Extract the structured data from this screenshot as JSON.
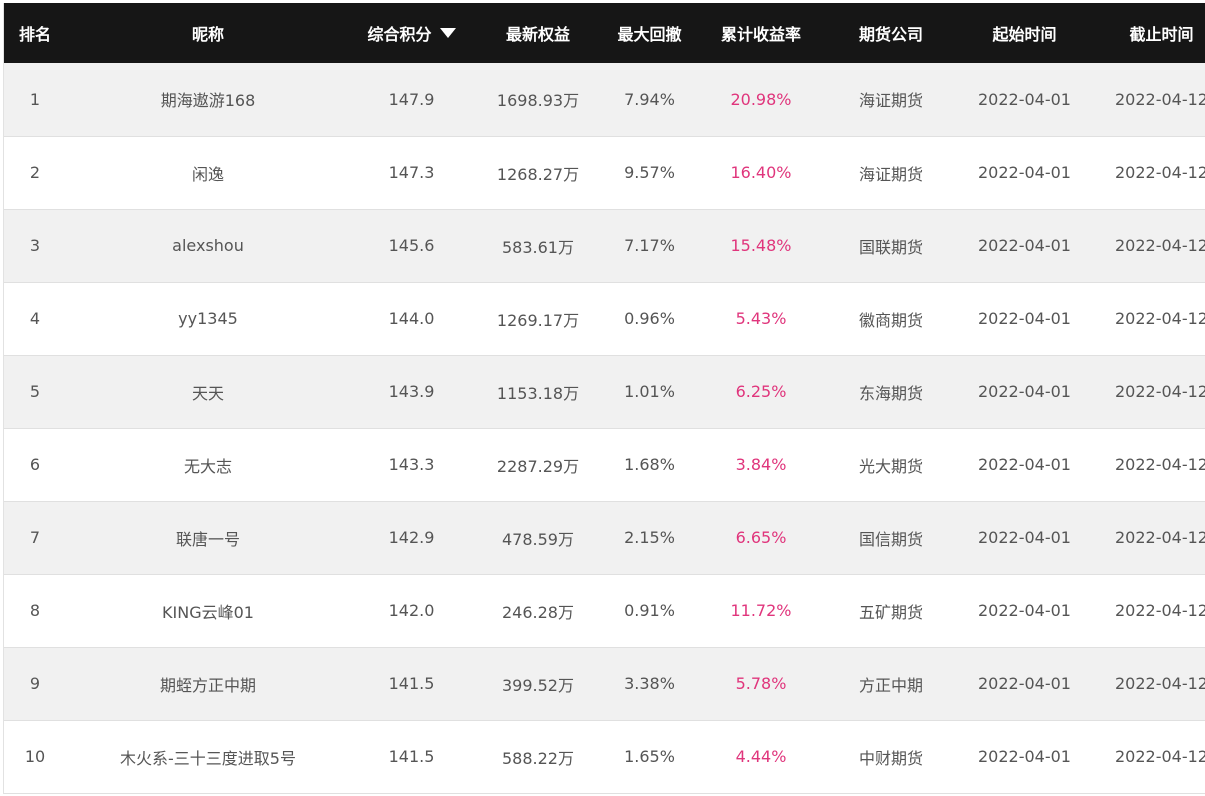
{
  "columns": {
    "rank": "排名",
    "nickname": "昵称",
    "score": "综合积分",
    "equity": "最新权益",
    "drawdown": "最大回撤",
    "return": "累计收益率",
    "company": "期货公司",
    "start": "起始时间",
    "end": "截止时间"
  },
  "sort_icon": "triangle-down-icon",
  "accent_color": "#e0357c",
  "rows": [
    {
      "rank": "1",
      "nickname": "期海遨游168",
      "score": "147.9",
      "equity": "1698.93万",
      "drawdown": "7.94%",
      "return": "20.98%",
      "company": "海证期货",
      "start": "2022-04-01",
      "end": "2022-04-12"
    },
    {
      "rank": "2",
      "nickname": "闲逸",
      "score": "147.3",
      "equity": "1268.27万",
      "drawdown": "9.57%",
      "return": "16.40%",
      "company": "海证期货",
      "start": "2022-04-01",
      "end": "2022-04-12"
    },
    {
      "rank": "3",
      "nickname": "alexshou",
      "score": "145.6",
      "equity": "583.61万",
      "drawdown": "7.17%",
      "return": "15.48%",
      "company": "国联期货",
      "start": "2022-04-01",
      "end": "2022-04-12"
    },
    {
      "rank": "4",
      "nickname": "yy1345",
      "score": "144.0",
      "equity": "1269.17万",
      "drawdown": "0.96%",
      "return": "5.43%",
      "company": "徽商期货",
      "start": "2022-04-01",
      "end": "2022-04-12"
    },
    {
      "rank": "5",
      "nickname": "天天",
      "score": "143.9",
      "equity": "1153.18万",
      "drawdown": "1.01%",
      "return": "6.25%",
      "company": "东海期货",
      "start": "2022-04-01",
      "end": "2022-04-12"
    },
    {
      "rank": "6",
      "nickname": "无大志",
      "score": "143.3",
      "equity": "2287.29万",
      "drawdown": "1.68%",
      "return": "3.84%",
      "company": "光大期货",
      "start": "2022-04-01",
      "end": "2022-04-12"
    },
    {
      "rank": "7",
      "nickname": "联唐一号",
      "score": "142.9",
      "equity": "478.59万",
      "drawdown": "2.15%",
      "return": "6.65%",
      "company": "国信期货",
      "start": "2022-04-01",
      "end": "2022-04-12"
    },
    {
      "rank": "8",
      "nickname": "KING云峰01",
      "score": "142.0",
      "equity": "246.28万",
      "drawdown": "0.91%",
      "return": "11.72%",
      "company": "五矿期货",
      "start": "2022-04-01",
      "end": "2022-04-12"
    },
    {
      "rank": "9",
      "nickname": "期蛭方正中期",
      "score": "141.5",
      "equity": "399.52万",
      "drawdown": "3.38%",
      "return": "5.78%",
      "company": "方正中期",
      "start": "2022-04-01",
      "end": "2022-04-12"
    },
    {
      "rank": "10",
      "nickname": "木火系-三十三度进取5号",
      "score": "141.5",
      "equity": "588.22万",
      "drawdown": "1.65%",
      "return": "4.44%",
      "company": "中财期货",
      "start": "2022-04-01",
      "end": "2022-04-12"
    }
  ]
}
